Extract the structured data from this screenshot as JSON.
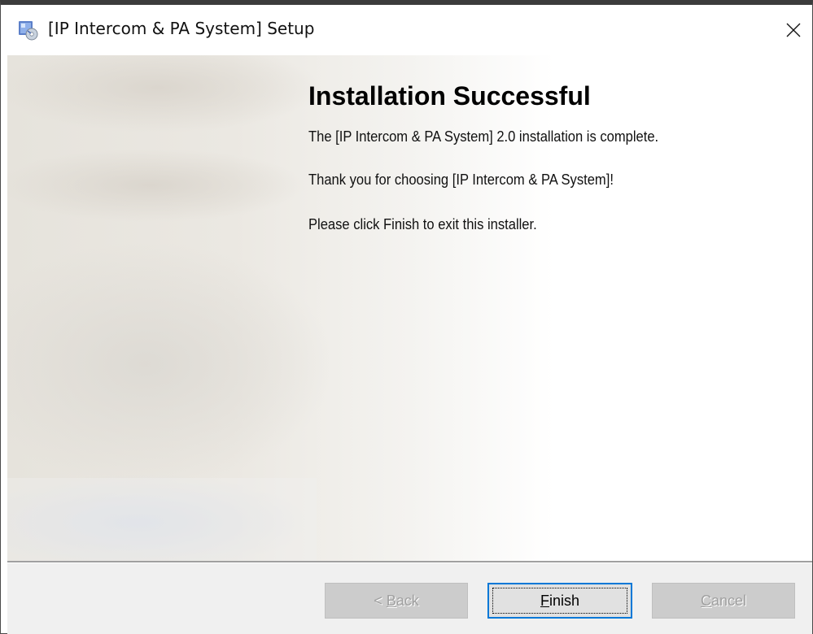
{
  "window": {
    "title": "[IP Intercom & PA System] Setup"
  },
  "content": {
    "heading": "Installation Successful",
    "lines": [
      "The [IP Intercom & PA System] 2.0 installation is complete.",
      "Thank you for choosing [IP Intercom & PA System]!",
      "Please click Finish to exit this installer."
    ]
  },
  "buttons": {
    "back": {
      "prefix": "< ",
      "mnemonic": "B",
      "rest": "ack",
      "enabled": false
    },
    "finish": {
      "prefix": "",
      "mnemonic": "F",
      "rest": "inish",
      "enabled": true
    },
    "cancel": {
      "prefix": "",
      "mnemonic": "C",
      "rest": "ancel",
      "enabled": false
    }
  },
  "icons": {
    "app": "installer-app-icon",
    "close": "close-icon",
    "background": "face-background-art"
  },
  "colors": {
    "focus_border": "#0078d7",
    "button_face": "#e1e1e1",
    "footer_bg": "#f0f0f0",
    "disabled_button": "#cccccc"
  }
}
